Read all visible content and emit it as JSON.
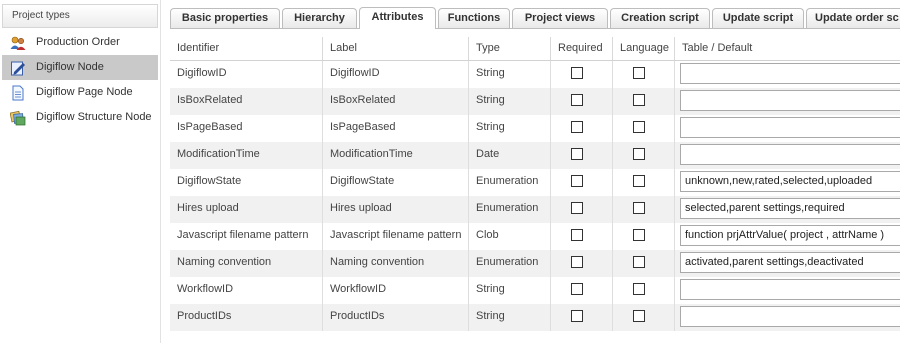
{
  "sidebar": {
    "header": "Project types",
    "items": [
      {
        "label": "Production Order",
        "icon": "users-icon"
      },
      {
        "label": "Digiflow Node",
        "icon": "edit-document-icon"
      },
      {
        "label": "Digiflow Page Node",
        "icon": "page-icon"
      },
      {
        "label": "Digiflow Structure Node",
        "icon": "stack-icon"
      }
    ]
  },
  "tabs": [
    {
      "label": "Basic properties"
    },
    {
      "label": "Hierarchy"
    },
    {
      "label": "Attributes"
    },
    {
      "label": "Functions"
    },
    {
      "label": "Project views"
    },
    {
      "label": "Creation script"
    },
    {
      "label": "Update script"
    },
    {
      "label": "Update order sc"
    }
  ],
  "table": {
    "columns": [
      "Identifier",
      "Label",
      "Type",
      "Required",
      "Language",
      "Table / Default"
    ],
    "rows": [
      {
        "identifier": "DigiflowID",
        "label": "DigiflowID",
        "type": "String",
        "default": ""
      },
      {
        "identifier": "IsBoxRelated",
        "label": "IsBoxRelated",
        "type": "String",
        "default": ""
      },
      {
        "identifier": "IsPageBased",
        "label": "IsPageBased",
        "type": "String",
        "default": ""
      },
      {
        "identifier": "ModificationTime",
        "label": "ModificationTime",
        "type": "Date",
        "default": ""
      },
      {
        "identifier": "DigiflowState",
        "label": "DigiflowState",
        "type": "Enumeration",
        "default": "unknown,new,rated,selected,uploaded"
      },
      {
        "identifier": "Hires upload",
        "label": "Hires upload",
        "type": "Enumeration",
        "default": "selected,parent settings,required"
      },
      {
        "identifier": "Javascript filename pattern",
        "label": "Javascript filename pattern",
        "type": "Clob",
        "default": "function prjAttrValue( project , attrName )"
      },
      {
        "identifier": "Naming convention",
        "label": "Naming convention",
        "type": "Enumeration",
        "default": "activated,parent settings,deactivated"
      },
      {
        "identifier": "WorkflowID",
        "label": "WorkflowID",
        "type": "String",
        "default": ""
      },
      {
        "identifier": "ProductIDs",
        "label": "ProductIDs",
        "type": "String",
        "default": ""
      }
    ]
  }
}
